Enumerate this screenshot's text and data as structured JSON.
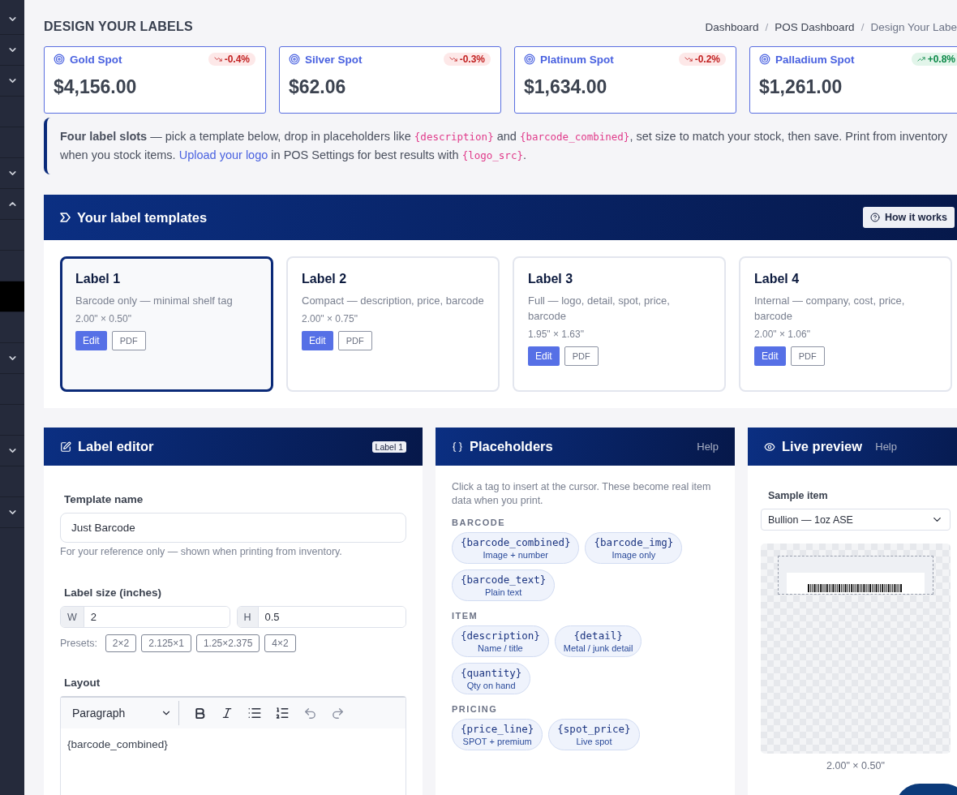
{
  "sidebar": {
    "items": [
      {
        "kind": "group",
        "expanded": false,
        "selected": false
      },
      {
        "kind": "group",
        "expanded": false,
        "selected": false
      },
      {
        "kind": "group",
        "expanded": false,
        "selected": false
      },
      {
        "kind": "link",
        "selected": false
      },
      {
        "kind": "link",
        "selected": false
      },
      {
        "kind": "group",
        "expanded": false,
        "selected": false
      },
      {
        "kind": "group",
        "expanded": true,
        "selected": false
      },
      {
        "kind": "link",
        "selected": false
      },
      {
        "kind": "link",
        "selected": false
      },
      {
        "kind": "link",
        "selected": true
      },
      {
        "kind": "link",
        "selected": false
      },
      {
        "kind": "group",
        "expanded": false,
        "selected": false
      },
      {
        "kind": "link",
        "selected": false
      },
      {
        "kind": "link",
        "selected": false
      },
      {
        "kind": "group",
        "expanded": false,
        "selected": false
      },
      {
        "kind": "link",
        "selected": false
      },
      {
        "kind": "group",
        "expanded": false,
        "selected": false
      }
    ]
  },
  "page_title": "DESIGN YOUR LABELS",
  "breadcrumb": {
    "separator": "/",
    "items": [
      {
        "label": "Dashboard",
        "current": false
      },
      {
        "label": "POS Dashboard",
        "current": false
      },
      {
        "label": "Design Your Labe",
        "current": true
      }
    ]
  },
  "spot_prices": [
    {
      "label": "Gold Spot",
      "price": "$4,156.00",
      "change": "-0.4%",
      "rising": false
    },
    {
      "label": "Silver Spot",
      "price": "$62.06",
      "change": "-0.3%",
      "rising": false
    },
    {
      "label": "Platinum Spot",
      "price": "$1,634.00",
      "change": "-0.2%",
      "rising": false
    },
    {
      "label": "Palladium Spot",
      "price": "$1,261.00",
      "change": "+0.8%",
      "rising": true
    }
  ],
  "notice": [
    {
      "kind": "bold",
      "text": "Four label slots"
    },
    {
      "kind": "text",
      "text": " — pick a template below, drop in placeholders like "
    },
    {
      "kind": "code",
      "text": "{description}"
    },
    {
      "kind": "text",
      "text": " and "
    },
    {
      "kind": "code",
      "text": "{barcode_combined}"
    },
    {
      "kind": "text",
      "text": ", set size to match your stock, then save. Print from inventory when you stock items. "
    },
    {
      "kind": "link",
      "text": "Upload your logo"
    },
    {
      "kind": "text",
      "text": " in POS Settings for best results with "
    },
    {
      "kind": "code",
      "text": "{logo_src}"
    },
    {
      "kind": "text",
      "text": "."
    }
  ],
  "templates_panel": {
    "title": "Your label templates",
    "help_button": "How it works",
    "templates": [
      {
        "name": "Label 1",
        "description": "Barcode only — minimal shelf tag",
        "size": "2.00\" × 0.50\"",
        "edit": "Edit",
        "pdf": "PDF",
        "selected": true
      },
      {
        "name": "Label 2",
        "description": "Compact — description, price, barcode",
        "size": "2.00\" × 0.75\"",
        "edit": "Edit",
        "pdf": "PDF",
        "selected": false
      },
      {
        "name": "Label 3",
        "description": "Full — logo, detail, spot, price, barcode",
        "size": "1.95\" × 1.63\"",
        "edit": "Edit",
        "pdf": "PDF",
        "selected": false
      },
      {
        "name": "Label 4",
        "description": "Internal — company, cost, price, barcode",
        "size": "2.00\" × 1.06\"",
        "edit": "Edit",
        "pdf": "PDF",
        "selected": false
      }
    ]
  },
  "editor": {
    "title": "Label editor",
    "badge": "Label 1",
    "name_label": "Template name",
    "name_value": "Just Barcode",
    "name_hint": "For your reference only — shown when printing from inventory.",
    "size_label": "Label size (inches)",
    "width_prefix": "W",
    "width_value": "2",
    "height_prefix": "H",
    "height_value": "0.5",
    "presets_label": "Presets:",
    "presets": [
      "2×2",
      "2.125×1",
      "1.25×2.375",
      "4×2"
    ],
    "layout_label": "Layout",
    "block_style": "Paragraph",
    "content": "{barcode_combined}"
  },
  "placeholders": {
    "title": "Placeholders",
    "help": "Help",
    "intro": "Click a tag to insert at the cursor. These become real item data when you print.",
    "groups": [
      {
        "name": "BARCODE",
        "tags": [
          {
            "tag": "{barcode_combined}",
            "hint": "Image + number"
          },
          {
            "tag": "{barcode_img}",
            "hint": "Image only"
          },
          {
            "tag": "{barcode_text}",
            "hint": "Plain text"
          }
        ]
      },
      {
        "name": "ITEM",
        "tags": [
          {
            "tag": "{description}",
            "hint": "Name / title"
          },
          {
            "tag": "{detail}",
            "hint": "Metal / junk detail"
          },
          {
            "tag": "{quantity}",
            "hint": "Qty on hand"
          }
        ]
      },
      {
        "name": "PRICING",
        "tags": [
          {
            "tag": "{price_line}",
            "hint": "SPOT + premium"
          },
          {
            "tag": "{spot_price}",
            "hint": "Live spot"
          }
        ]
      }
    ]
  },
  "preview": {
    "title": "Live preview",
    "help": "Help",
    "sample_label": "Sample item",
    "sample_value": "Bullion — 1oz ASE",
    "size": "2.00\" × 0.50\""
  }
}
